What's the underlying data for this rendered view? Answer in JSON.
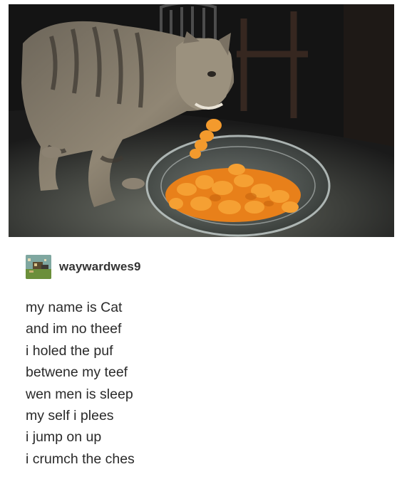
{
  "post": {
    "username": "waywardwes9",
    "avatar_icon": "pixel-art-avatar-icon",
    "photo_subject": "cat-eating-cheese-puffs-image",
    "poem_lines": [
      "my name is Cat",
      "and im no theef",
      "i holed the puf",
      "betwene my teef",
      "wen men is sleep",
      "my self i plees",
      "i jump on up",
      "i crumch the ches"
    ]
  },
  "colors": {
    "background": "#ffffff",
    "text": "#2a2a2a",
    "username": "#333333",
    "cheese_puff": "#f08a1c"
  }
}
